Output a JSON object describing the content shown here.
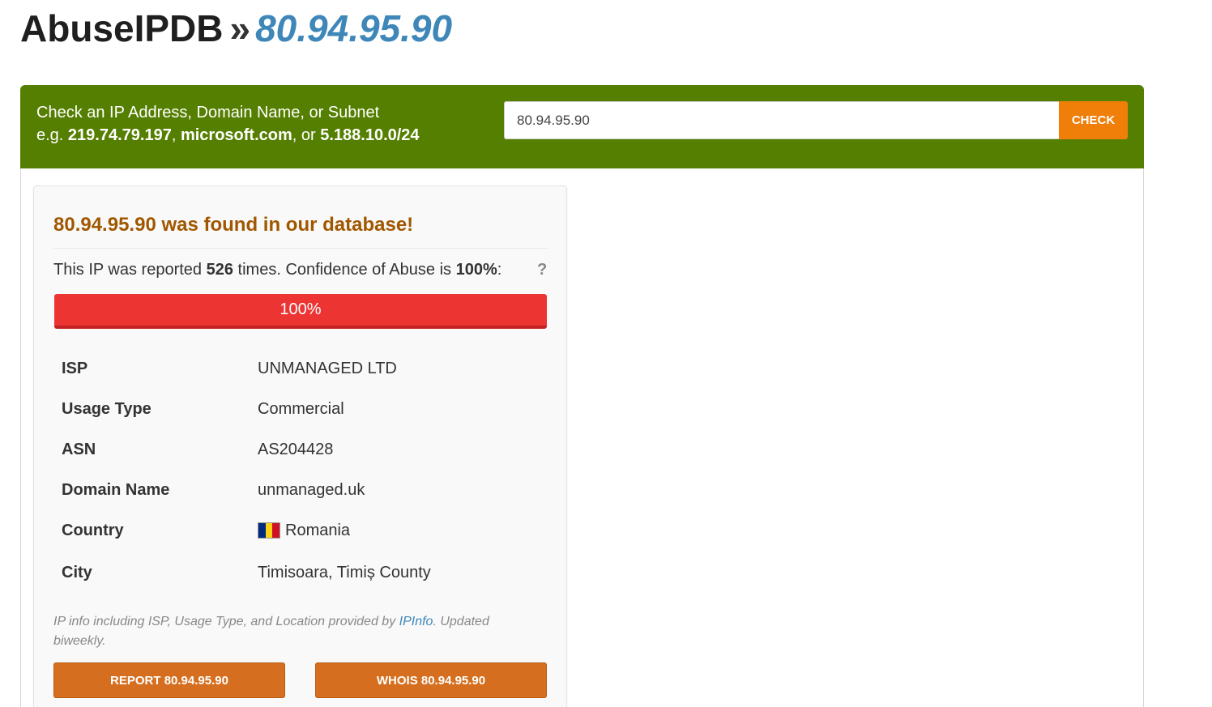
{
  "header": {
    "brand": "AbuseIPDB",
    "separator": "»",
    "ip": "80.94.95.90"
  },
  "check_bar": {
    "line1": "Check an IP Address, Domain Name, or Subnet",
    "example_prefix": "e.g. ",
    "example_ip": "219.74.79.197",
    "example_sep1": ", ",
    "example_domain": "microsoft.com",
    "example_sep2": ", or ",
    "example_subnet": "5.188.10.0/24",
    "input_value": "80.94.95.90",
    "check_label": "CHECK"
  },
  "result": {
    "heading_ip": "80.94.95.90",
    "heading_suffix": " was found in our database!",
    "reported_prefix": "This IP was reported ",
    "reported_count": "526",
    "reported_mid": " times. Confidence of Abuse is ",
    "confidence": "100%",
    "reported_suffix": ":",
    "help_glyph": "?",
    "confidence_bar": {
      "value_percent": 100,
      "label": "100%",
      "color": "#ec3433"
    },
    "rows": [
      {
        "label": "ISP",
        "value": "UNMANAGED LTD"
      },
      {
        "label": "Usage Type",
        "value": "Commercial"
      },
      {
        "label": "ASN",
        "value": "AS204428"
      },
      {
        "label": "Domain Name",
        "value": "unmanaged.uk"
      },
      {
        "label": "Country",
        "value": "Romania",
        "flag": [
          "#002b7f",
          "#fcd116",
          "#ce1126"
        ]
      },
      {
        "label": "City",
        "value": "Timisoara, Timiș County"
      }
    ],
    "note_prefix": "IP info including ISP, Usage Type, and Location provided by ",
    "note_link": "IPInfo",
    "note_suffix": ". Updated biweekly.",
    "report_button": "REPORT 80.94.95.90",
    "whois_button": "WHOIS 80.94.95.90"
  },
  "colors": {
    "brand_green": "#557f00",
    "check_orange": "#f07f09",
    "action_orange": "#d56f1f",
    "heading_brown": "#a05700",
    "link_blue": "#3e87b8"
  }
}
